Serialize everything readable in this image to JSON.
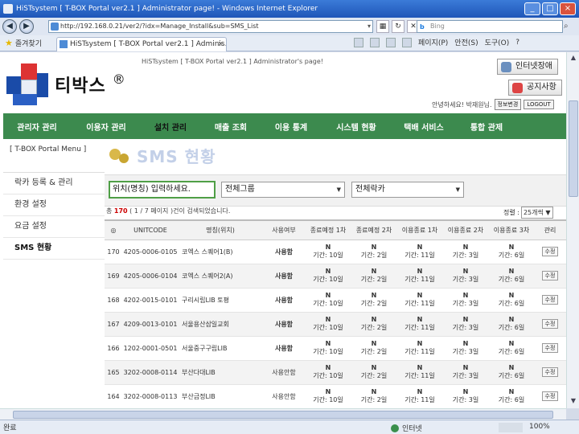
{
  "browser": {
    "title": "HiSTsystem [ T-BOX Portal ver2.1 ] Administrator page! - Windows Internet Explorer",
    "url": "http://192.168.0.21/ver2/?idx=Manage_Install&sub=SMS_List",
    "search_placeholder": "Bing",
    "favorites": "즐겨찾기",
    "tab_label": "HiSTsystem [ T-BOX Portal ver2.1 ] Adminis...",
    "page_menu": "페이지(P)",
    "safety_menu": "안전(S)",
    "tools_menu": "도구(O)",
    "status": "완료",
    "zone": "인터넷",
    "zoom": "100%"
  },
  "header": {
    "brand": "티박스",
    "reg": "®",
    "site_title": "HiSTsystem [ T-BOX Portal ver2.1 ] Administrator's page!",
    "btn_fault": "인터넷장애",
    "btn_notice": "공지사항",
    "greeting": "안녕하세요! 박재원님.",
    "btn_info": "정보변경",
    "btn_logout": "LOGOUT"
  },
  "nav": [
    "관리자 관리",
    "이용자 관리",
    "설치 관리",
    "매출 조회",
    "이용 통계",
    "시스템 현황",
    "택배 서비스",
    "통합 관제"
  ],
  "sidebar": {
    "title": "[ T-BOX Portal Menu ]",
    "items": [
      "락카 등록 & 관리",
      "환경 설정",
      "요금 설정",
      "SMS 현황"
    ]
  },
  "page_title": "SMS 현황",
  "filter": {
    "search_text": "위치(명칭) 입력하세요.",
    "group": "전체그룹",
    "locker": "전체락카"
  },
  "count": {
    "prefix": "총",
    "total": "170",
    "suffix": "( 1 / 7 페이지 )건이 검색되었습니다.",
    "sort_label": "정렬 :",
    "sort_value": "25개씩"
  },
  "table": {
    "headers": [
      "◎",
      "UNITCODE",
      "명칭(위치)",
      "사용여부",
      "종료예정 1차",
      "종료예정 2차",
      "이용종료 1차",
      "이용종료 2차",
      "이용종료 3차",
      "관리"
    ],
    "edit_label": "수정",
    "rows": [
      {
        "no": "170",
        "code": "4205-0006-0105",
        "name": "코엑스 스퀘어1(B)",
        "use": "사용함",
        "cells": [
          [
            "N",
            "기간: 10일"
          ],
          [
            "N",
            "기간: 2일"
          ],
          [
            "N",
            "기간: 11일"
          ],
          [
            "N",
            "기간: 3일"
          ],
          [
            "N",
            "기간: 6일"
          ]
        ]
      },
      {
        "no": "169",
        "code": "4205-0006-0104",
        "name": "코엑스 스퀘어2(A)",
        "use": "사용함",
        "cells": [
          [
            "N",
            "기간: 10일"
          ],
          [
            "N",
            "기간: 2일"
          ],
          [
            "N",
            "기간: 11일"
          ],
          [
            "N",
            "기간: 3일"
          ],
          [
            "N",
            "기간: 6일"
          ]
        ]
      },
      {
        "no": "168",
        "code": "4202-0015-0101",
        "name": "구리시립LIB 토평",
        "use": "사용함",
        "cells": [
          [
            "N",
            "기간: 10일"
          ],
          [
            "N",
            "기간: 2일"
          ],
          [
            "N",
            "기간: 11일"
          ],
          [
            "N",
            "기간: 3일"
          ],
          [
            "N",
            "기간: 6일"
          ]
        ]
      },
      {
        "no": "167",
        "code": "4209-0013-0101",
        "name": "서울용산삼일교회",
        "use": "사용함",
        "cells": [
          [
            "N",
            "기간: 10일"
          ],
          [
            "N",
            "기간: 2일"
          ],
          [
            "N",
            "기간: 11일"
          ],
          [
            "N",
            "기간: 3일"
          ],
          [
            "N",
            "기간: 6일"
          ]
        ]
      },
      {
        "no": "166",
        "code": "1202-0001-0501",
        "name": "서울중구구립LIB",
        "use": "사용함",
        "cells": [
          [
            "N",
            "기간: 10일"
          ],
          [
            "N",
            "기간: 2일"
          ],
          [
            "N",
            "기간: 11일"
          ],
          [
            "N",
            "기간: 3일"
          ],
          [
            "N",
            "기간: 6일"
          ]
        ]
      },
      {
        "no": "165",
        "code": "3202-0008-0114",
        "name": "부산다대LIB",
        "use": "사용안함",
        "cells": [
          [
            "N",
            "기간: 10일"
          ],
          [
            "N",
            "기간: 2일"
          ],
          [
            "N",
            "기간: 11일"
          ],
          [
            "N",
            "기간: 3일"
          ],
          [
            "N",
            "기간: 6일"
          ]
        ]
      },
      {
        "no": "164",
        "code": "3202-0008-0113",
        "name": "부산금정LIB",
        "use": "사용안함",
        "cells": [
          [
            "N",
            "기간: 10일"
          ],
          [
            "N",
            "기간: 2일"
          ],
          [
            "N",
            "기간: 11일"
          ],
          [
            "N",
            "기간: 3일"
          ],
          [
            "N",
            "기간: 6일"
          ]
        ]
      }
    ]
  }
}
